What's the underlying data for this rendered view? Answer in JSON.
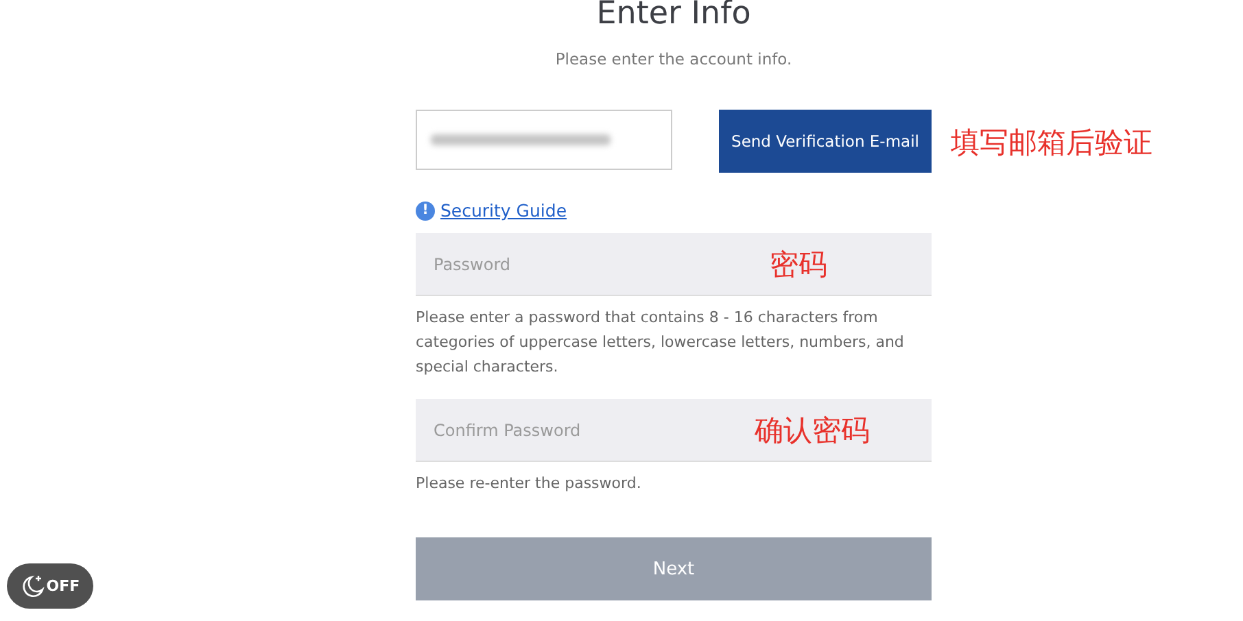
{
  "title": "Enter Info",
  "subtitle": "Please enter the account info.",
  "email": {
    "send_button": "Send Verification E-mail",
    "annotation": "填写邮箱后验证"
  },
  "security_guide": {
    "icon": "!",
    "label": "Security Guide"
  },
  "password": {
    "placeholder": "Password",
    "annotation": "密码",
    "hint": "Please enter a password that contains 8 - 16 characters from categories of uppercase letters, lowercase letters, numbers, and special characters."
  },
  "confirm_password": {
    "placeholder": "Confirm Password",
    "annotation": "确认密码",
    "hint": "Please re-enter the password."
  },
  "next_button": {
    "label": "Next",
    "disabled": true
  },
  "night_mode": {
    "label": "OFF",
    "on": false
  }
}
